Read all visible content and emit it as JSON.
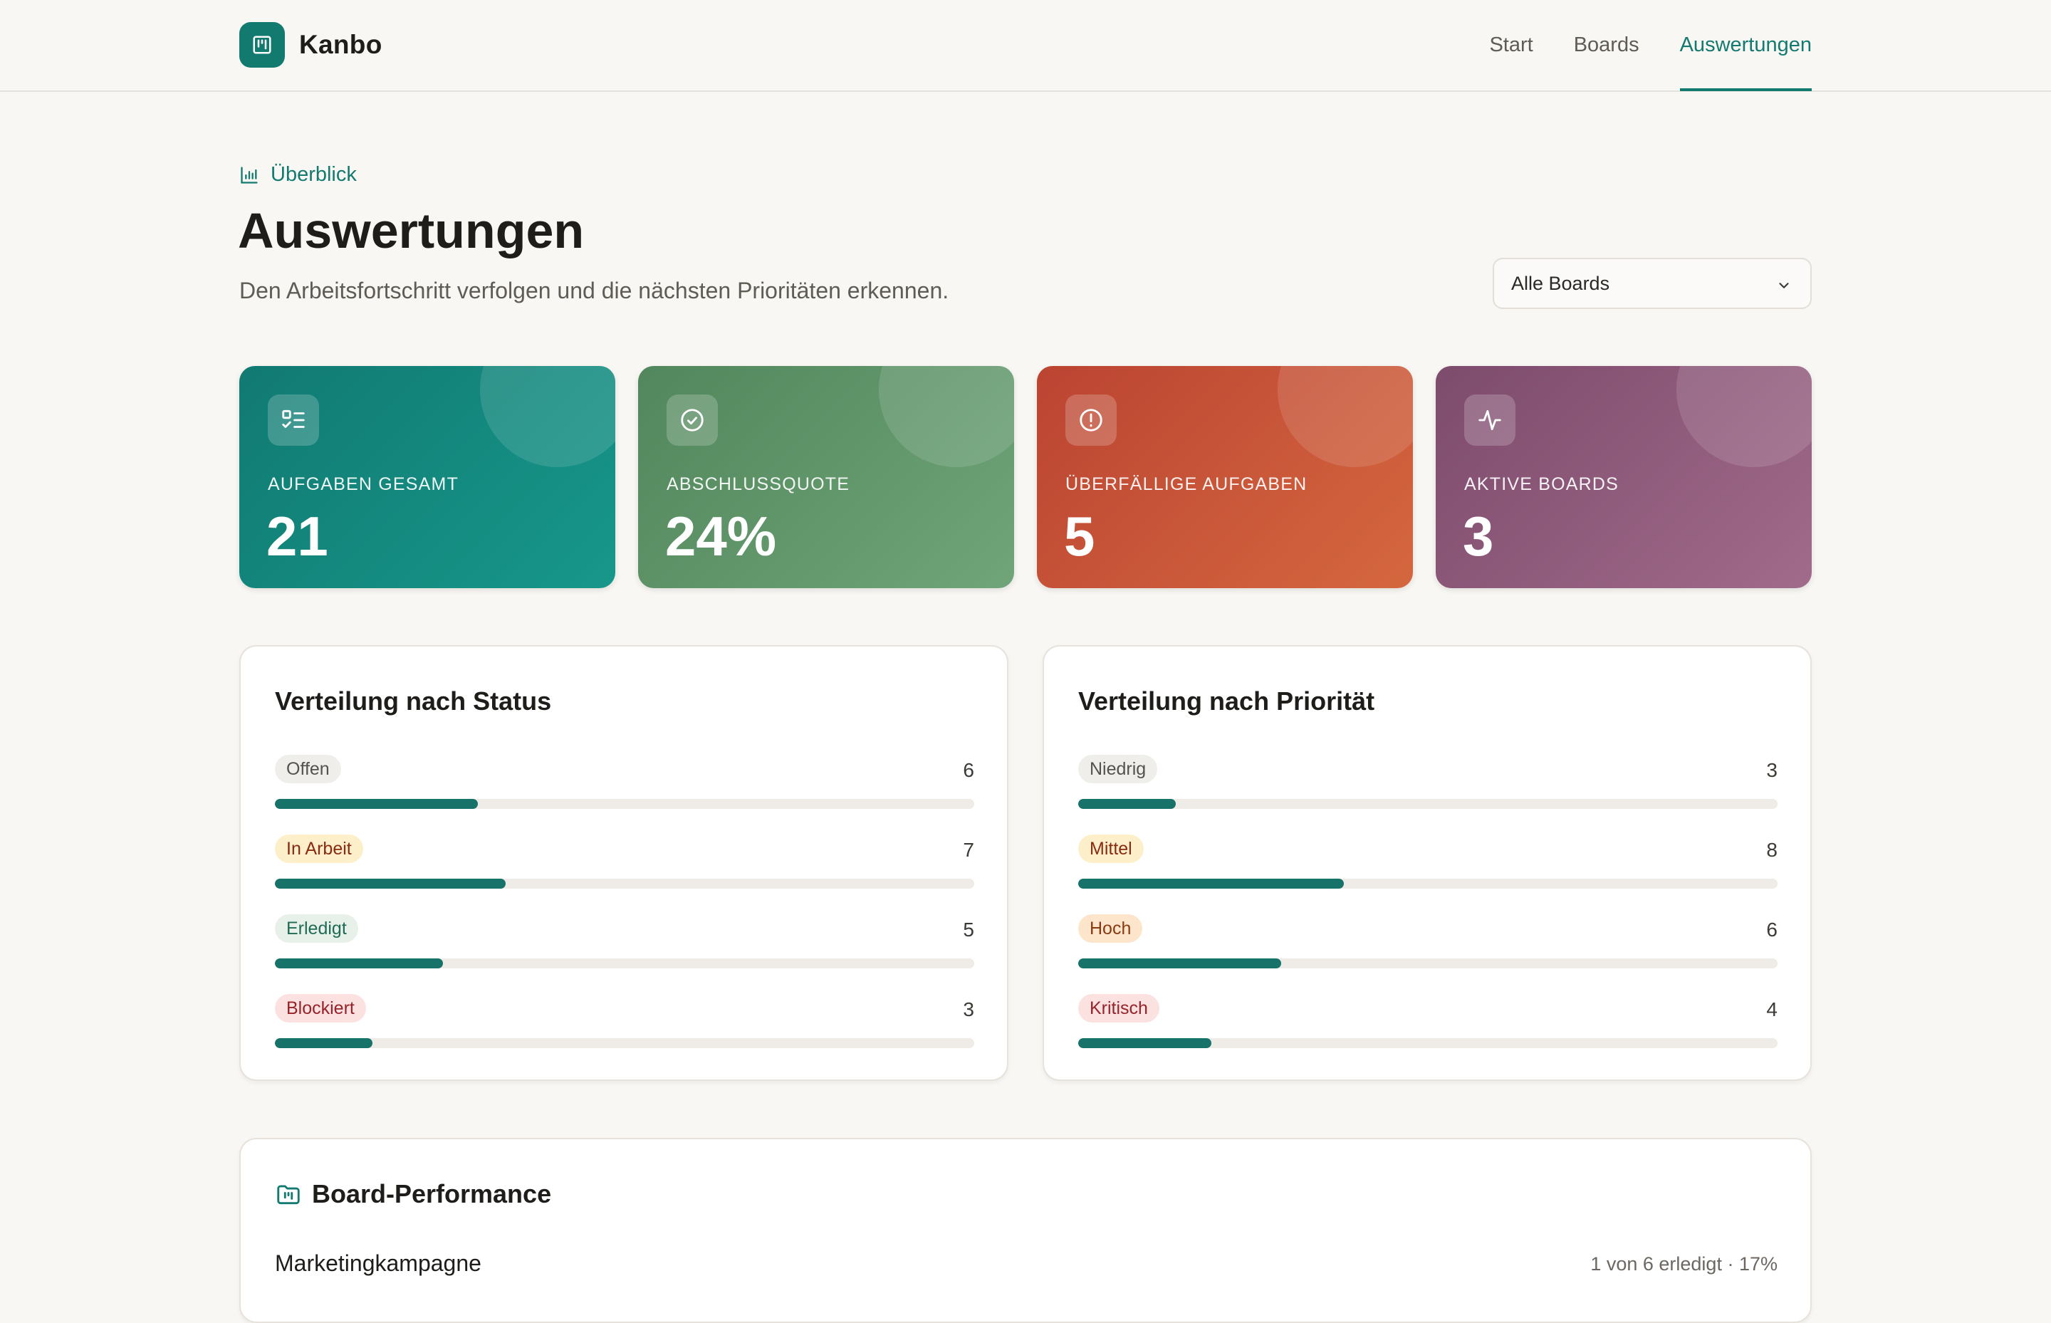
{
  "app": {
    "name": "Kanbo",
    "nav": [
      {
        "label": "Start",
        "active": false
      },
      {
        "label": "Boards",
        "active": false
      },
      {
        "label": "Auswertungen",
        "active": true
      }
    ]
  },
  "page": {
    "breadcrumb": "Überblick",
    "title": "Auswertungen",
    "subtitle": "Den Arbeitsfortschritt verfolgen und die nächsten Prioritäten erkennen.",
    "board_filter": {
      "selected": "Alle Boards"
    }
  },
  "kpis": [
    {
      "label": "AUFGABEN GESAMT",
      "value": "21",
      "icon": "task-list-icon",
      "color": "#137a70"
    },
    {
      "label": "ABSCHLUSSQUOTE",
      "value": "24%",
      "icon": "check-circle-icon",
      "color": "#5e9468"
    },
    {
      "label": "ÜBERFÄLLIGE AUFGABEN",
      "value": "5",
      "icon": "alert-circle-icon",
      "color": "#c85538"
    },
    {
      "label": "AKTIVE BOARDS",
      "value": "3",
      "icon": "activity-icon",
      "color": "#8f5b7c"
    }
  ],
  "status_panel": {
    "title": "Verteilung nach Status",
    "rows": [
      {
        "label": "Offen",
        "count": "6",
        "fraction": 0.29
      },
      {
        "label": "In Arbeit",
        "count": "7",
        "fraction": 0.33
      },
      {
        "label": "Erledigt",
        "count": "5",
        "fraction": 0.24
      },
      {
        "label": "Blockiert",
        "count": "3",
        "fraction": 0.14
      }
    ]
  },
  "priority_panel": {
    "title": "Verteilung nach Priorität",
    "rows": [
      {
        "label": "Niedrig",
        "count": "3",
        "fraction": 0.14
      },
      {
        "label": "Mittel",
        "count": "8",
        "fraction": 0.38
      },
      {
        "label": "Hoch",
        "count": "6",
        "fraction": 0.29
      },
      {
        "label": "Kritisch",
        "count": "4",
        "fraction": 0.19
      }
    ]
  },
  "performance": {
    "title": "Board-Performance",
    "boards": [
      {
        "name": "Marketingkampagne",
        "stat": "1 von 6 erledigt · 17%"
      }
    ]
  },
  "colors": {
    "accent": "#137a70",
    "background": "#f9f7f3",
    "bar_fill": "#177269",
    "bar_track": "#efece7"
  }
}
